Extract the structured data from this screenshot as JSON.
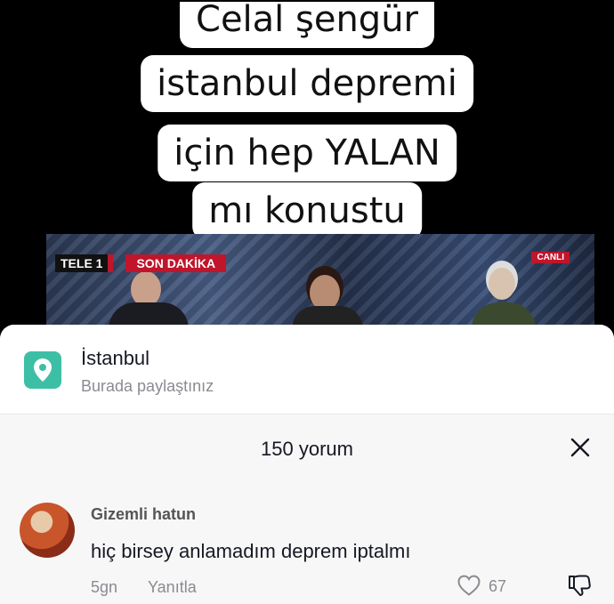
{
  "video": {
    "caption_lines": [
      "Celal şengür",
      "istanbul depremi",
      "için hep YALAN",
      "mı konustu"
    ],
    "channel_logo": "TELE 1",
    "banner": "SON DAKİKA",
    "live_badge": "CANLI"
  },
  "location": {
    "icon": "location-pin-icon",
    "accent": "#3dbfa6",
    "name": "İstanbul",
    "subtitle": "Burada paylaştınız"
  },
  "comments": {
    "title": "150 yorum",
    "close_icon": "close-icon",
    "items": [
      {
        "user": "Gizemli hatun",
        "text": "hiç birsey anlamadım deprem iptalmı",
        "time": "5gn",
        "reply_label": "Yanıtla",
        "likes": "67"
      }
    ]
  }
}
